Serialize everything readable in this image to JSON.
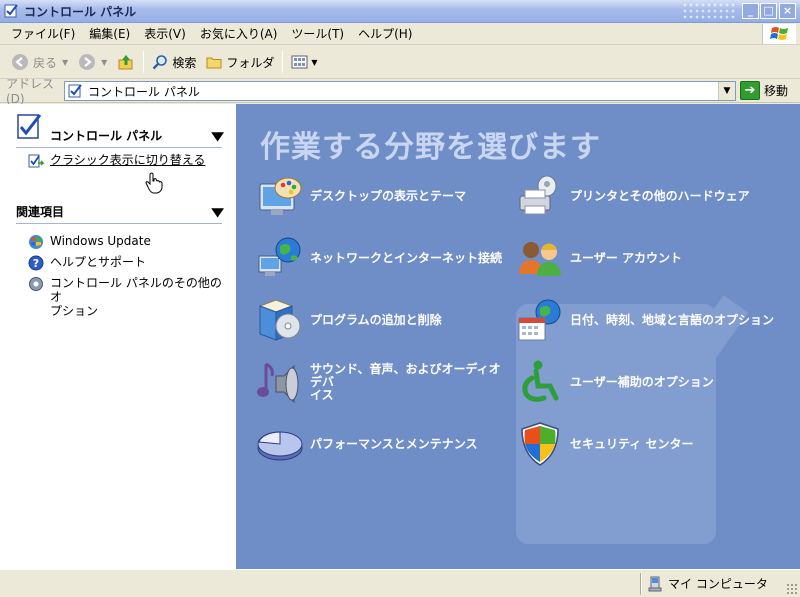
{
  "window": {
    "title": "コントロール パネル"
  },
  "menu": [
    "ファイル(F)",
    "編集(E)",
    "表示(V)",
    "お気に入り(A)",
    "ツール(T)",
    "ヘルプ(H)"
  ],
  "toolbar": {
    "back": "戻る",
    "search": "検索",
    "folders": "フォルダ"
  },
  "address": {
    "label": "アドレス(D)",
    "value": "コントロール パネル",
    "go": "移動"
  },
  "sidebar": {
    "cp_title": "コントロール パネル",
    "switch_link": "クラシック表示に切り替える",
    "related_title": "関連項目",
    "related": [
      "Windows Update",
      "ヘルプとサポート",
      "コントロール パネルのその他のオ\nプション"
    ]
  },
  "main": {
    "heading": "作業する分野を選びます",
    "categories": [
      "デスクトップの表示とテーマ",
      "プリンタとその他のハードウェア",
      "ネットワークとインターネット接続",
      "ユーザー アカウント",
      "プログラムの追加と削除",
      "日付、時刻、地域と言語のオプション",
      "サウンド、音声、およびオーディオ デバ\nイス",
      "ユーザー補助のオプション",
      "パフォーマンスとメンテナンス",
      "セキュリティ センター"
    ]
  },
  "status": {
    "location": "マイ コンピュータ"
  }
}
